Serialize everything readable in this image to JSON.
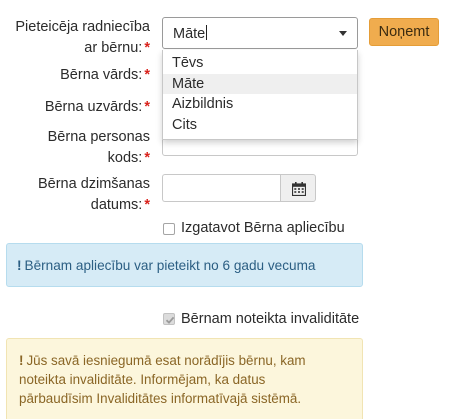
{
  "form": {
    "relation_label_line1": "Pieteicēja radniecība",
    "relation_label_line2": "ar bērnu:",
    "child_name_label": "Bērna vārds:",
    "child_surname_label": "Bērna uzvārds:",
    "personal_code_label_line1": "Bērna personas",
    "personal_code_label_line2": "kods:",
    "birth_date_label_line1": "Bērna dzimšanas",
    "birth_date_label_line2": "datums:",
    "required_mark": "*"
  },
  "relation_select": {
    "value": "Māte",
    "options": [
      "Tēvs",
      "Māte",
      "Aizbildnis",
      "Cits"
    ],
    "highlighted_index": 1
  },
  "remove_button": {
    "label": "Noņemt"
  },
  "birth_cert_checkbox": {
    "label": "Izgatavot Bērna apliecību",
    "checked": false
  },
  "info_alert": {
    "icon": "!",
    "text": "Bērnam apliecību var pieteikt no 6 gadu vecuma"
  },
  "disability_checkbox": {
    "label": "Bērnam noteikta invaliditāte",
    "checked": true,
    "disabled": true
  },
  "warning_alert": {
    "icon": "!",
    "line1": "Jūs savā iesniegumā esat norādījis bērnu, kam",
    "line2": "noteikta invaliditāte. Informējam, ka datus",
    "line3": "pārbaudīsim Invaliditātes informatīvajā sistēmā."
  },
  "colors": {
    "required": "#d9231d",
    "button_accent": "#f0ac4e",
    "info_bg": "#d6ebf6",
    "info_text": "#2b5e83",
    "warning_bg": "#fcf6dc",
    "warning_text": "#8a6626"
  }
}
